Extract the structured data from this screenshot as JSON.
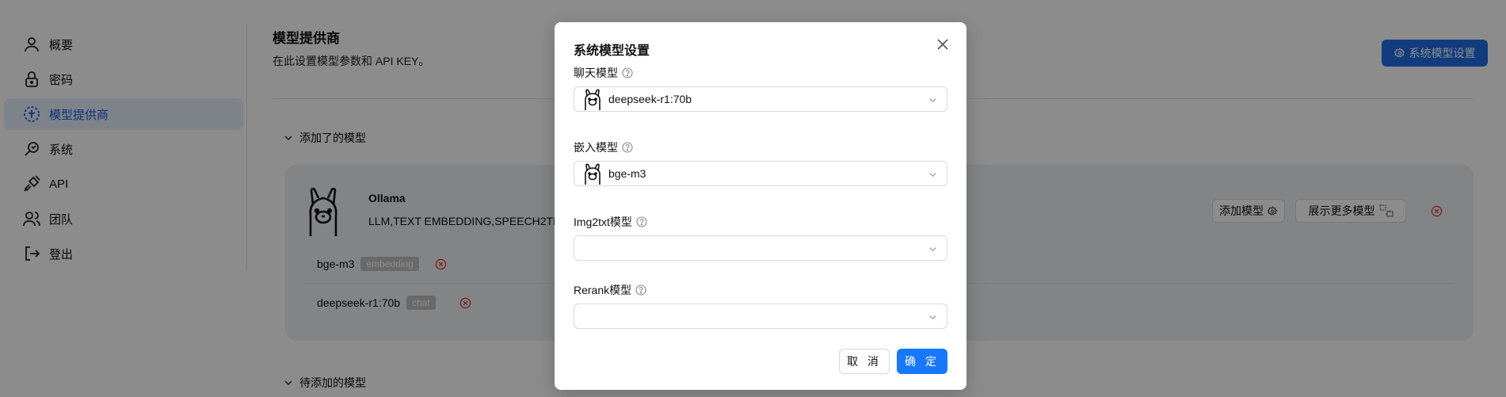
{
  "sidebar": {
    "items": [
      {
        "label": "概要",
        "icon": "user-icon"
      },
      {
        "label": "密码",
        "icon": "lock-icon"
      },
      {
        "label": "模型提供商",
        "icon": "model-box-icon",
        "active": true
      },
      {
        "label": "系统",
        "icon": "system-icon"
      },
      {
        "label": "API",
        "icon": "plug-icon"
      },
      {
        "label": "团队",
        "icon": "team-icon"
      },
      {
        "label": "登出",
        "icon": "logout-icon"
      }
    ]
  },
  "header": {
    "title": "模型提供商",
    "subtitle": "在此设置模型参数和 API KEY。",
    "system_settings_button": "系统模型设置"
  },
  "added_section": {
    "title": "添加了的模型",
    "provider": {
      "name": "Ollama",
      "tags": "LLM,TEXT EMBEDDING,SPEECH2TEXT",
      "add_model_button": "添加模型",
      "show_more_button": "展示更多模型",
      "models": [
        {
          "name": "bge-m3",
          "type": "embedding"
        },
        {
          "name": "deepseek-r1:70b",
          "type": "chat"
        }
      ]
    }
  },
  "pending_section": {
    "title": "待添加的模型"
  },
  "modal": {
    "title": "系统模型设置",
    "fields": [
      {
        "label": "聊天模型",
        "value": "deepseek-r1:70b"
      },
      {
        "label": "嵌入模型",
        "value": "bge-m3"
      },
      {
        "label": "Img2txt模型",
        "value": ""
      },
      {
        "label": "Rerank模型",
        "value": ""
      }
    ],
    "cancel_label": "取 消",
    "ok_label": "确 定"
  },
  "colors": {
    "primary": "#1677ff",
    "danger": "#e23b3b",
    "active_bg": "#e6eefc"
  }
}
